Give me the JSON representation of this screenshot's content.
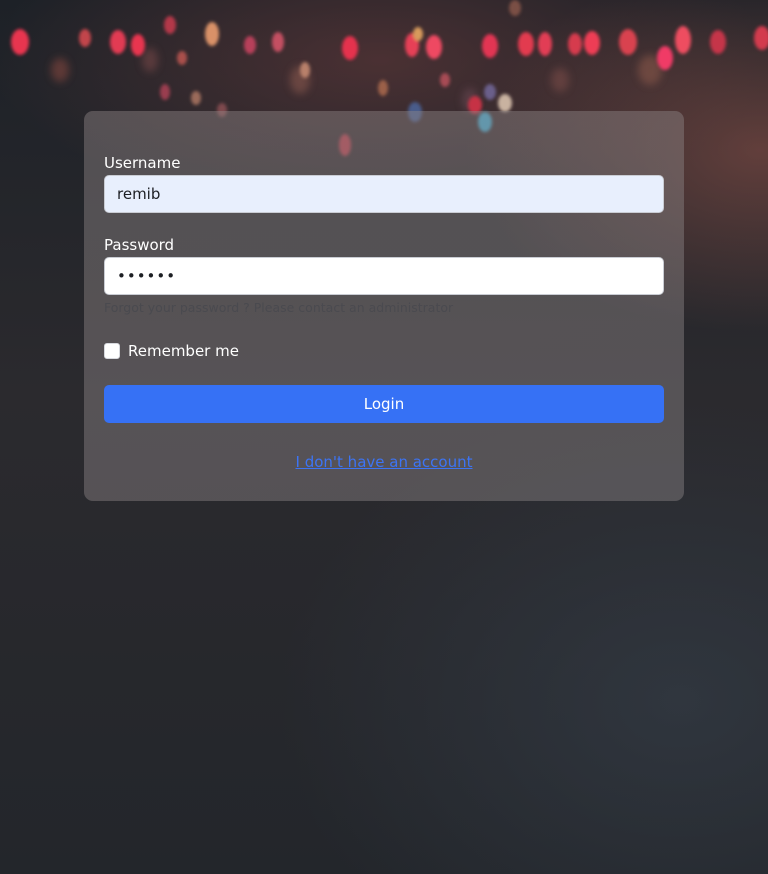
{
  "login_form": {
    "username_label": "Username",
    "username_value": "remib",
    "password_label": "Password",
    "password_value": "••••••",
    "forgot_hint": "Forgot your password ? Please contact an administrator",
    "remember_label": "Remember me",
    "remember_checked": false,
    "login_label": "Login",
    "no_account_link": "I don't have an account"
  },
  "colors": {
    "accent": "#3671f5",
    "link": "#3d74f4",
    "autofill_background": "#e8effd"
  }
}
